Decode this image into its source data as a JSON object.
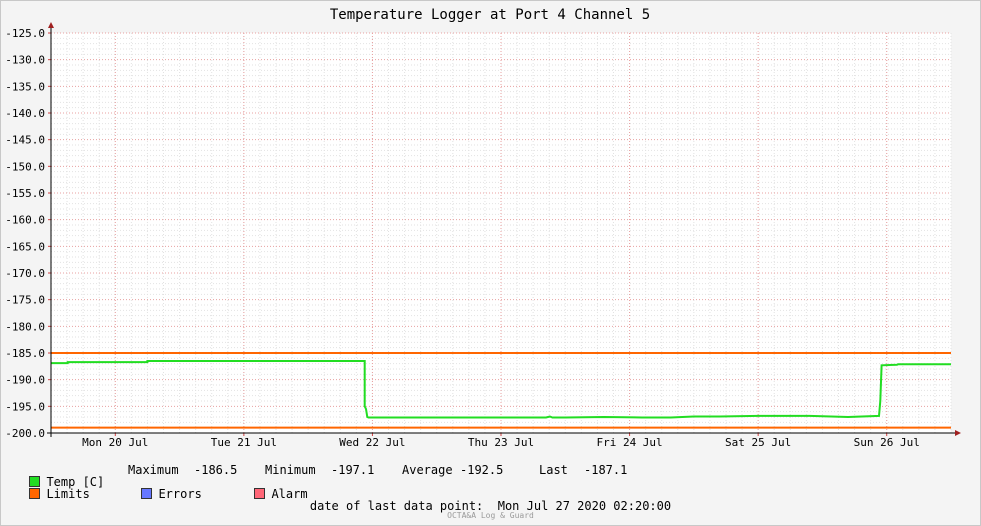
{
  "chart_data": {
    "type": "line",
    "title": "Temperature Logger at Port 4 Channel 5",
    "ylim": [
      -200,
      -125
    ],
    "y_ticks": [
      "-125.0",
      "-130.0",
      "-135.0",
      "-140.0",
      "-145.0",
      "-150.0",
      "-155.0",
      "-160.0",
      "-165.0",
      "-170.0",
      "-175.0",
      "-180.0",
      "-185.0",
      "-190.0",
      "-195.0",
      "-200.0"
    ],
    "x_range_days": [
      0,
      7
    ],
    "x_ticks": [
      {
        "label": "Mon 20 Jul",
        "day": 0.5
      },
      {
        "label": "Tue 21 Jul",
        "day": 1.5
      },
      {
        "label": "Wed 22 Jul",
        "day": 2.5
      },
      {
        "label": "Thu 23 Jul",
        "day": 3.5
      },
      {
        "label": "Fri 24 Jul",
        "day": 4.5
      },
      {
        "label": "Sat 25 Jul",
        "day": 5.5
      },
      {
        "label": "Sun 26 Jul",
        "day": 6.5
      }
    ],
    "limits": {
      "upper": -185.0,
      "lower": -199.0
    },
    "grid": true,
    "series": [
      {
        "name": "Temp [C]",
        "color": "#22dd22",
        "x": [
          0.0,
          0.13,
          0.13,
          0.75,
          0.75,
          2.44,
          2.44,
          2.45,
          2.46,
          2.47,
          3.5,
          3.85,
          3.88,
          3.9,
          4.0,
          4.3,
          4.6,
          4.82,
          5.0,
          5.2,
          5.5,
          5.9,
          6.2,
          6.44,
          6.45,
          6.46,
          6.58,
          6.59,
          7.0
        ],
        "values": [
          -186.9,
          -186.9,
          -186.7,
          -186.7,
          -186.5,
          -186.5,
          -195.0,
          -195.5,
          -197.0,
          -197.1,
          -197.1,
          -197.1,
          -196.9,
          -197.1,
          -197.1,
          -197.0,
          -197.1,
          -197.1,
          -196.9,
          -196.9,
          -196.8,
          -196.8,
          -197.0,
          -196.8,
          -194.0,
          -187.3,
          -187.2,
          -187.1,
          -187.1
        ]
      }
    ]
  },
  "legend": {
    "temp_label": "Temp [C]",
    "maximum_label": "Maximum",
    "maximum_value": "-186.5",
    "minimum_label": "Minimum",
    "minimum_value": "-197.1",
    "average_label": "Average",
    "average_value": "-192.5",
    "last_label": "Last",
    "last_value": "-187.1",
    "limits_label": "Limits",
    "errors_label": "Errors",
    "alarm_label": "Alarm",
    "colors": {
      "temp": "#22dd22",
      "limits": "#ff6600",
      "errors": "#6677ff",
      "alarm": "#ff6677"
    }
  },
  "footer": {
    "date_text": "date of last data point:  Mon Jul 27 2020 02:20:00",
    "watermark": "OCTA&A Log & Guard"
  }
}
